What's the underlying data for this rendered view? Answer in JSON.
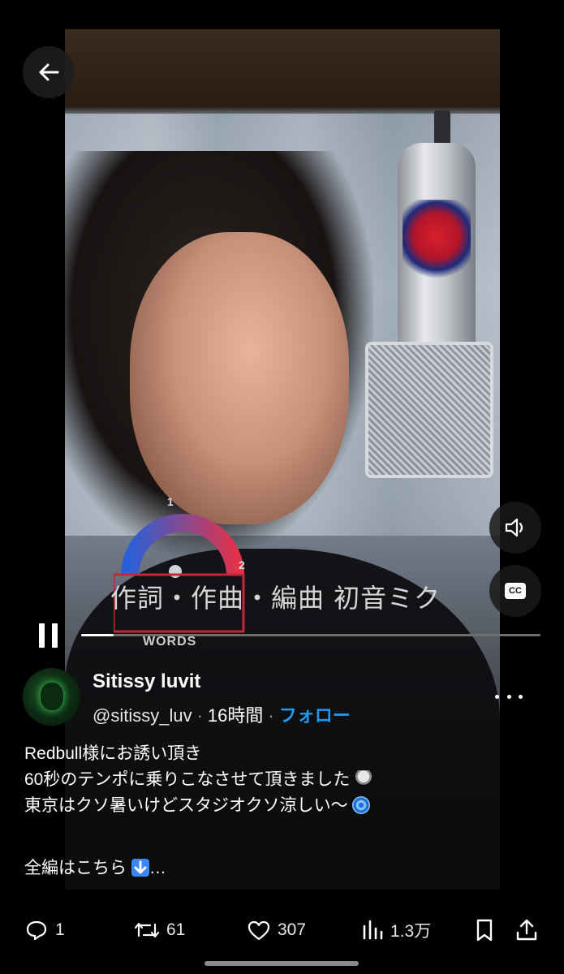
{
  "video": {
    "subtitle": "作詞・作曲・編曲 初音ミク",
    "dial_number_1": "1",
    "dial_number_2": "2",
    "dial_label": "WORDS",
    "cc_label": "CC"
  },
  "player": {
    "progress_fraction": 0.07
  },
  "author": {
    "name": "Sitissy luvit",
    "handle": "@sitissy_luv",
    "separator": "·",
    "time": "16時間",
    "follow_label": "フォロー"
  },
  "tweet": {
    "line1": "Redbull様にお誘い頂き",
    "line2": "60秒のテンポに乗りこなさせて頂きました",
    "line3": "東京はクソ暑いけどスタジオクソ涼しい〜",
    "line4": "全編はこちら",
    "line4_suffix": "…"
  },
  "actions": {
    "replies": "1",
    "reposts": "61",
    "likes": "307",
    "views": "1.3万"
  },
  "icons": {
    "back": "arrow-left-icon",
    "volume": "speaker-icon",
    "cc": "closed-captions-icon",
    "more": "more-horizontal-icon",
    "reply": "comment-icon",
    "repost": "repost-icon",
    "like": "heart-icon",
    "views": "bar-chart-icon",
    "bookmark": "bookmark-icon",
    "share": "share-icon"
  },
  "colors": {
    "accent": "#1d9bf0",
    "background": "#000000"
  }
}
